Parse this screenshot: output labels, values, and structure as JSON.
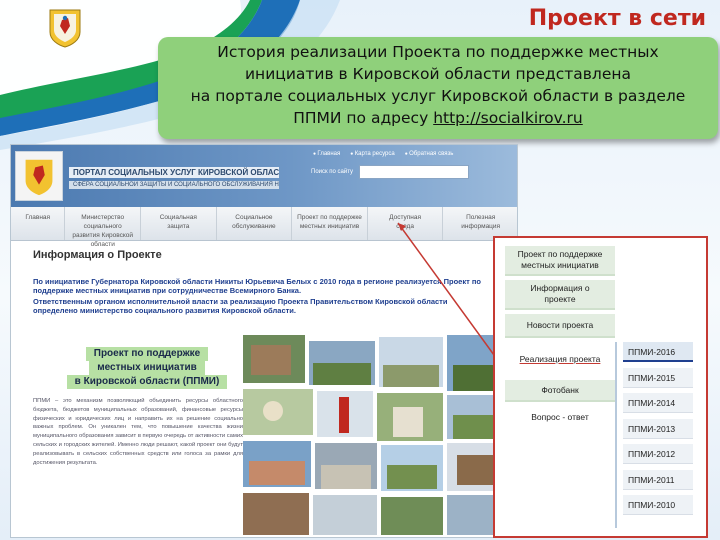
{
  "slide": {
    "title": "Проект в сети",
    "callout": {
      "line1": "История реализации Проекта по поддержке местных",
      "line2": "инициатив в Кировской области представлена",
      "line3": "на портале социальных услуг Кировской области в разделе",
      "line4_prefix": "ППМИ по адресу ",
      "link": "http://socialkirov.ru"
    }
  },
  "site": {
    "portal_title": "ПОРТАЛ СОЦИАЛЬНЫХ УСЛУГ КИРОВСКОЙ ОБЛАСТИ",
    "portal_subtitle": "СФЕРА СОЦИАЛЬНОЙ ЗАЩИТЫ И СОЦИАЛЬНОГО ОБСЛУЖИВАНИЯ НАСЕЛЕНИЯ",
    "top_links": [
      "Главная",
      "Карта ресурса",
      "Обратная связь"
    ],
    "search_label": "Поиск по сайту",
    "nav": [
      "Главная",
      "Министерство социального\nразвития Кировской области",
      "Социальная\nзащита",
      "Социальное\nобслуживание",
      "Проект по поддержке\nместных инициатив",
      "Доступная\nсреда",
      "Полезная\nинформация"
    ],
    "info_title": "Информация о Проекте",
    "info_p1": "По инициативе Губернатора Кировской области Никиты Юрьевича Белых с 2010 года в регионе реализуется Проект по поддержке местных инициатив при сотрудничестве Всемирного Банка.",
    "info_p2": "Ответственным органом исполнительной власти за реализацию Проекта Правительством Кировской области определено министерство социального развития Кировской области.",
    "ppmi_banner": [
      "Проект по поддержке",
      "местных инициатив",
      "в Кировской области (ППМИ)"
    ],
    "ppmi_desc": "ППМИ – это механизм позволяющий объединить ресурсы областного бюджета, бюджетов муниципальных образований, финансовые ресурсы физических и юридических лиц и направить их на решение социально важных проблем. Он уникален тем, что повышение качества жизни муниципального образования зависит в первую очередь от активности самих сельских и городских жителей. Именно люди решают, какой проект они будут реализовывать в сельских собственных средств или голоса за рамки для достижения результата."
  },
  "menu": {
    "items": [
      "Проект по поддержке\nместных инициатив",
      "Информация о\nпроекте",
      "Новости проекта",
      "Реализация проекта",
      "Фотобанк",
      "Вопрос - ответ"
    ],
    "years": [
      "ППМИ-2016",
      "ППМИ-2015",
      "ППМИ-2014",
      "ППМИ-2013",
      "ППМИ-2012",
      "ППМИ-2011",
      "ППМИ-2010"
    ]
  },
  "colors": {
    "title_red": "#c0281f",
    "callout_green": "#8fd07b",
    "site_blue": "#4b79b0",
    "panel_border": "#c53a33",
    "info_text": "#1f3f8f"
  }
}
